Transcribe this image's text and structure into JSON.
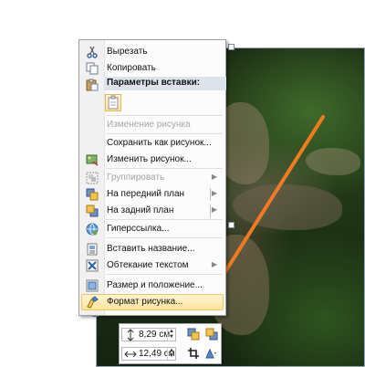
{
  "context_menu": {
    "items": [
      {
        "label": "Вырезать",
        "icon": "scissors-icon",
        "enabled": true
      },
      {
        "label": "Копировать",
        "icon": "copy-icon",
        "enabled": true
      },
      {
        "label": "Параметры вставки:",
        "icon": "paste-icon",
        "header": true
      },
      {
        "label": "Изменение рисунка",
        "enabled": false
      },
      {
        "label": "Сохранить как рисунок...",
        "enabled": true
      },
      {
        "label": "Изменить рисунок...",
        "icon": "change-picture-icon",
        "enabled": true
      },
      {
        "label": "Группировать",
        "icon": "group-icon",
        "enabled": false,
        "submenu": true
      },
      {
        "label": "На передний план",
        "icon": "bring-forward-icon",
        "enabled": true,
        "submenu": true
      },
      {
        "label": "На задний план",
        "icon": "send-backward-icon",
        "enabled": true,
        "submenu": true
      },
      {
        "label": "Гиперссылка...",
        "icon": "hyperlink-icon",
        "enabled": true
      },
      {
        "label": "Вставить название...",
        "icon": "caption-icon",
        "enabled": true
      },
      {
        "label": "Обтекание текстом",
        "icon": "text-wrap-icon",
        "enabled": true,
        "submenu": true
      },
      {
        "label": "Размер и положение...",
        "icon": "size-position-icon",
        "enabled": true
      },
      {
        "label": "Формат рисунка...",
        "icon": "format-picture-icon",
        "enabled": true,
        "highlighted": true
      }
    ]
  },
  "mini_toolbar": {
    "height_value": "8,29 см",
    "width_value": "12,49 см"
  },
  "colors": {
    "arrow": "#f07b22",
    "highlight": "#ffe49b"
  }
}
